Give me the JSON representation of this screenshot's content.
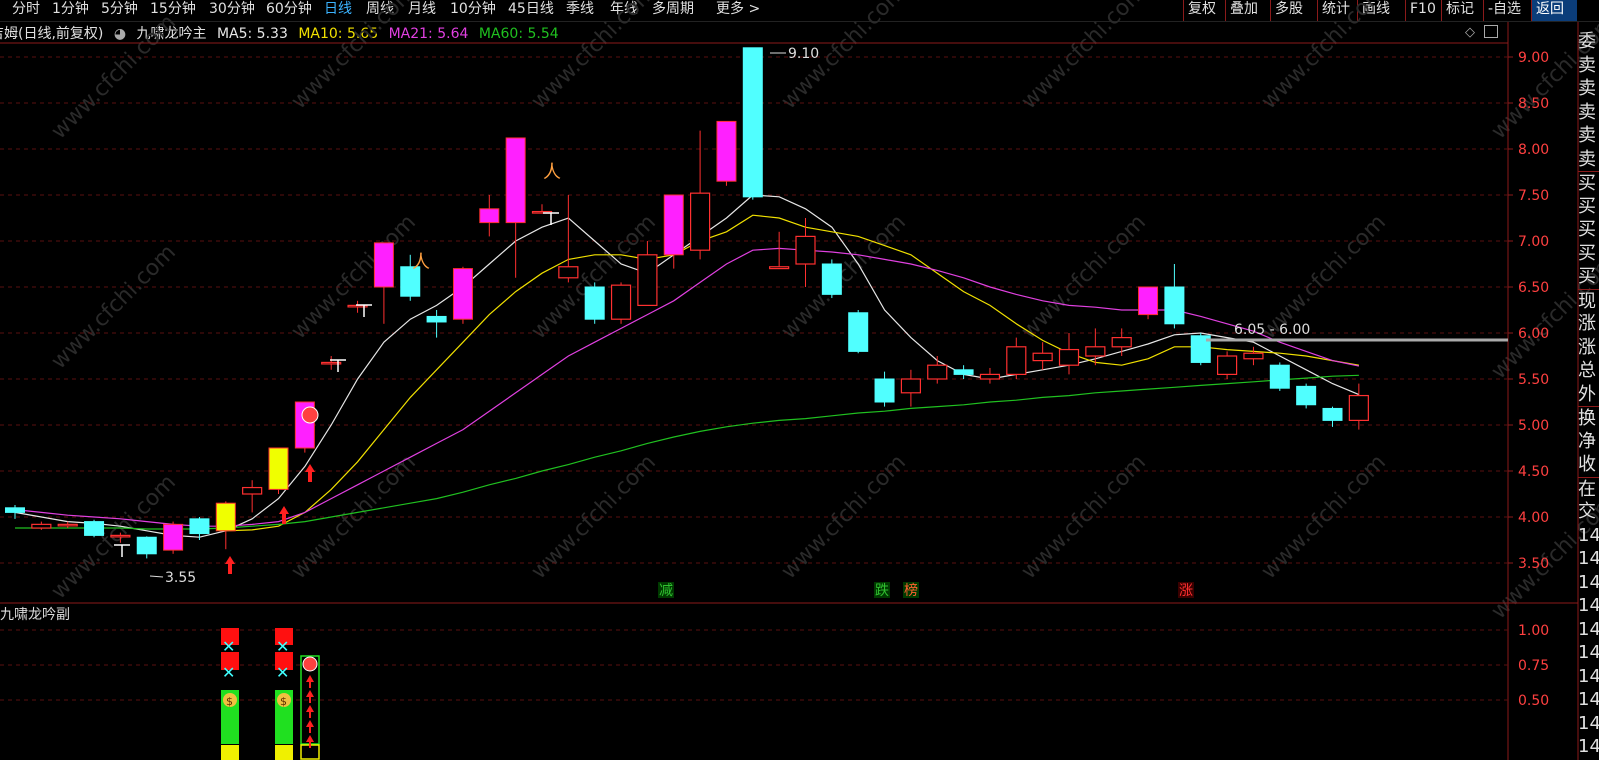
{
  "toolbar": {
    "periods": [
      "分时",
      "1分钟",
      "5分钟",
      "15分钟",
      "30分钟",
      "60分钟",
      "日线",
      "周线",
      "月线",
      "10分钟",
      "45日线",
      "季线",
      "年线",
      "多周期",
      "更多 >"
    ],
    "active_period": "日线",
    "right_buttons": [
      "复权",
      "叠加",
      "多股",
      "统计",
      "画线",
      "F10",
      "标记",
      "-自选",
      "返回"
    ],
    "active_right": "返回"
  },
  "main_legend": {
    "stock": "吉姆(日线,前复权)",
    "indicator": "九啸龙吟主",
    "ma5": "MA5: 5.33",
    "ma10": "MA10: 5.65",
    "ma21": "MA21: 5.64",
    "ma60": "MA60: 5.54"
  },
  "colors": {
    "ma5": "#e6e6e6",
    "ma10": "#f0e000",
    "ma21": "#e040e0",
    "ma60": "#20c020",
    "up": "#ff3030",
    "down": "#50ffff",
    "magenta": "#ff20ff",
    "yellow": "#f0ff00",
    "grid": "#8b1a1a",
    "axis_text": "#ff4040"
  },
  "sub_title": "九啸龙吟副",
  "price_axis": [
    "9.00",
    "8.50",
    "8.00",
    "7.50",
    "7.00",
    "6.50",
    "6.00",
    "5.50",
    "5.00",
    "4.50",
    "4.00",
    "3.50"
  ],
  "sub_axis": [
    "1.00",
    "0.75",
    "0.50"
  ],
  "annotations": {
    "high": "9.10",
    "low": "3.55",
    "range": "6.05 - 6.00",
    "marker_jian": "减",
    "marker_die": "跌",
    "marker_bang": "榜",
    "marker_zhang": "涨"
  },
  "watermark": "www.cfchi.com",
  "right_panel": [
    "委",
    "卖",
    "卖",
    "卖",
    "卖",
    "卖",
    "买",
    "买",
    "买",
    "买",
    "买",
    "现",
    "涨",
    "涨",
    "总",
    "外",
    "换",
    "净",
    "收",
    "在",
    "交",
    "14",
    "14",
    "14",
    "14",
    "14",
    "14",
    "14",
    "14",
    "14",
    "14"
  ],
  "chart_data": {
    "type": "candlestick",
    "ylim": [
      3.3,
      9.2
    ],
    "candles": [
      {
        "o": 4.05,
        "c": 4.1,
        "h": 4.13,
        "l": 3.98,
        "s": "down"
      },
      {
        "o": 3.88,
        "c": 3.92,
        "h": 3.95,
        "l": 3.86,
        "s": "up"
      },
      {
        "o": 3.92,
        "c": 3.92,
        "h": 3.95,
        "l": 3.88,
        "s": "up"
      },
      {
        "o": 3.95,
        "c": 3.8,
        "h": 3.97,
        "l": 3.78,
        "s": "down"
      },
      {
        "o": 3.8,
        "c": 3.8,
        "h": 3.83,
        "l": 3.72,
        "s": "up"
      },
      {
        "o": 3.78,
        "c": 3.6,
        "h": 3.79,
        "l": 3.55,
        "s": "down"
      },
      {
        "o": 3.92,
        "c": 3.64,
        "h": 3.95,
        "l": 3.6,
        "s": "magenta"
      },
      {
        "o": 3.82,
        "c": 3.98,
        "h": 4.0,
        "l": 3.75,
        "s": "down"
      },
      {
        "o": 3.85,
        "c": 4.15,
        "h": 4.17,
        "l": 3.65,
        "s": "yellow"
      },
      {
        "o": 4.25,
        "c": 4.32,
        "h": 4.4,
        "l": 4.05,
        "s": "up"
      },
      {
        "o": 4.3,
        "c": 4.75,
        "h": 4.75,
        "l": 4.25,
        "s": "yellow"
      },
      {
        "o": 4.75,
        "c": 5.25,
        "h": 5.25,
        "l": 4.7,
        "s": "magenta"
      },
      {
        "o": 5.68,
        "c": 5.68,
        "h": 5.75,
        "l": 5.6,
        "s": "up"
      },
      {
        "o": 6.3,
        "c": 6.3,
        "h": 6.35,
        "l": 6.22,
        "s": "up"
      },
      {
        "o": 6.5,
        "c": 6.98,
        "h": 6.98,
        "l": 6.1,
        "s": "magenta"
      },
      {
        "o": 6.72,
        "c": 6.4,
        "h": 6.85,
        "l": 6.35,
        "s": "down"
      },
      {
        "o": 6.12,
        "c": 6.18,
        "h": 6.25,
        "l": 5.95,
        "s": "down"
      },
      {
        "o": 6.15,
        "c": 6.7,
        "h": 6.72,
        "l": 6.1,
        "s": "magenta"
      },
      {
        "o": 7.2,
        "c": 7.35,
        "h": 7.5,
        "l": 7.05,
        "s": "magenta"
      },
      {
        "o": 7.2,
        "c": 8.12,
        "h": 8.12,
        "l": 6.6,
        "s": "magenta"
      },
      {
        "o": 7.32,
        "c": 7.32,
        "h": 7.4,
        "l": 7.3,
        "s": "up"
      },
      {
        "o": 6.6,
        "c": 6.72,
        "h": 7.5,
        "l": 6.55,
        "s": "up"
      },
      {
        "o": 6.5,
        "c": 6.15,
        "h": 6.55,
        "l": 6.1,
        "s": "down"
      },
      {
        "o": 6.15,
        "c": 6.52,
        "h": 6.55,
        "l": 6.1,
        "s": "up"
      },
      {
        "o": 6.3,
        "c": 6.85,
        "h": 7.0,
        "l": 6.3,
        "s": "up"
      },
      {
        "o": 6.85,
        "c": 7.5,
        "h": 7.5,
        "l": 6.7,
        "s": "magenta"
      },
      {
        "o": 6.9,
        "c": 7.52,
        "h": 8.2,
        "l": 6.8,
        "s": "up"
      },
      {
        "o": 7.65,
        "c": 8.3,
        "h": 8.3,
        "l": 7.6,
        "s": "magenta"
      },
      {
        "o": 9.1,
        "c": 7.48,
        "h": 9.1,
        "l": 7.45,
        "s": "down"
      },
      {
        "o": 6.7,
        "c": 6.72,
        "h": 7.1,
        "l": 6.7,
        "s": "up"
      },
      {
        "o": 6.75,
        "c": 7.05,
        "h": 7.25,
        "l": 6.5,
        "s": "up"
      },
      {
        "o": 6.75,
        "c": 6.42,
        "h": 6.8,
        "l": 6.38,
        "s": "down"
      },
      {
        "o": 6.22,
        "c": 5.8,
        "h": 6.25,
        "l": 5.78,
        "s": "down"
      },
      {
        "o": 5.5,
        "c": 5.25,
        "h": 5.58,
        "l": 5.2,
        "s": "down"
      },
      {
        "o": 5.35,
        "c": 5.5,
        "h": 5.6,
        "l": 5.2,
        "s": "up"
      },
      {
        "o": 5.5,
        "c": 5.65,
        "h": 5.75,
        "l": 5.45,
        "s": "up"
      },
      {
        "o": 5.6,
        "c": 5.55,
        "h": 5.65,
        "l": 5.5,
        "s": "down"
      },
      {
        "o": 5.5,
        "c": 5.55,
        "h": 5.62,
        "l": 5.45,
        "s": "up"
      },
      {
        "o": 5.55,
        "c": 5.85,
        "h": 5.95,
        "l": 5.5,
        "s": "up"
      },
      {
        "o": 5.7,
        "c": 5.78,
        "h": 5.9,
        "l": 5.6,
        "s": "up"
      },
      {
        "o": 5.65,
        "c": 5.82,
        "h": 6.0,
        "l": 5.55,
        "s": "up"
      },
      {
        "o": 5.75,
        "c": 5.85,
        "h": 6.05,
        "l": 5.65,
        "s": "up"
      },
      {
        "o": 5.85,
        "c": 5.95,
        "h": 6.05,
        "l": 5.75,
        "s": "up"
      },
      {
        "o": 6.2,
        "c": 6.5,
        "h": 6.5,
        "l": 6.15,
        "s": "magenta"
      },
      {
        "o": 6.5,
        "c": 6.1,
        "h": 6.75,
        "l": 6.05,
        "s": "down"
      },
      {
        "o": 5.97,
        "c": 5.68,
        "h": 6.0,
        "l": 5.65,
        "s": "down"
      },
      {
        "o": 5.55,
        "c": 5.75,
        "h": 5.8,
        "l": 5.5,
        "s": "up"
      },
      {
        "o": 5.72,
        "c": 5.78,
        "h": 5.85,
        "l": 5.65,
        "s": "up"
      },
      {
        "o": 5.65,
        "c": 5.4,
        "h": 5.68,
        "l": 5.37,
        "s": "down"
      },
      {
        "o": 5.42,
        "c": 5.22,
        "h": 5.45,
        "l": 5.18,
        "s": "down"
      },
      {
        "o": 5.18,
        "c": 5.05,
        "h": 5.2,
        "l": 4.98,
        "s": "down"
      },
      {
        "o": 5.05,
        "c": 5.32,
        "h": 5.45,
        "l": 4.95,
        "s": "up"
      }
    ],
    "series": [
      {
        "name": "MA5",
        "values": [
          4.05,
          4.0,
          3.95,
          3.93,
          3.9,
          3.85,
          3.8,
          3.78,
          3.85,
          3.98,
          4.2,
          4.55,
          5.0,
          5.5,
          5.9,
          6.15,
          6.3,
          6.5,
          6.75,
          7.0,
          7.15,
          7.25,
          7.0,
          6.75,
          6.65,
          6.85,
          7.05,
          7.25,
          7.5,
          7.48,
          7.35,
          7.15,
          6.75,
          6.25,
          5.95,
          5.7,
          5.55,
          5.5,
          5.55,
          5.6,
          5.65,
          5.72,
          5.8,
          5.88,
          5.98,
          6.0,
          5.95,
          5.9,
          5.75,
          5.6,
          5.45,
          5.33
        ]
      },
      {
        "name": "MA10",
        "values": [
          null,
          null,
          null,
          null,
          null,
          null,
          null,
          null,
          3.85,
          3.86,
          3.9,
          4.05,
          4.3,
          4.6,
          4.95,
          5.3,
          5.6,
          5.9,
          6.2,
          6.45,
          6.65,
          6.8,
          6.85,
          6.85,
          6.8,
          6.85,
          7.0,
          7.1,
          7.28,
          7.25,
          7.15,
          7.1,
          7.05,
          6.95,
          6.85,
          6.65,
          6.45,
          6.3,
          6.1,
          5.92,
          5.78,
          5.68,
          5.65,
          5.72,
          5.85,
          5.85,
          5.82,
          5.8,
          5.78,
          5.75,
          5.7,
          5.65
        ]
      },
      {
        "name": "MA21",
        "values": [
          4.08,
          4.05,
          4.02,
          4.0,
          3.98,
          3.95,
          3.92,
          3.9,
          3.9,
          3.92,
          3.95,
          4.05,
          4.2,
          4.35,
          4.5,
          4.65,
          4.8,
          4.95,
          5.15,
          5.35,
          5.55,
          5.75,
          5.9,
          6.05,
          6.2,
          6.35,
          6.55,
          6.75,
          6.9,
          6.92,
          6.9,
          6.88,
          6.85,
          6.8,
          6.75,
          6.68,
          6.6,
          6.5,
          6.42,
          6.35,
          6.3,
          6.28,
          6.25,
          6.25,
          6.25,
          6.18,
          6.1,
          6.02,
          5.9,
          5.8,
          5.7,
          5.64
        ]
      },
      {
        "name": "MA60",
        "values": [
          3.88,
          3.88,
          3.88,
          3.88,
          3.88,
          3.87,
          3.87,
          3.87,
          3.88,
          3.9,
          3.92,
          3.95,
          4.0,
          4.05,
          4.1,
          4.15,
          4.2,
          4.27,
          4.35,
          4.42,
          4.5,
          4.57,
          4.65,
          4.72,
          4.8,
          4.87,
          4.93,
          4.98,
          5.02,
          5.05,
          5.07,
          5.1,
          5.13,
          5.15,
          5.18,
          5.2,
          5.22,
          5.25,
          5.27,
          5.3,
          5.32,
          5.35,
          5.37,
          5.39,
          5.41,
          5.43,
          5.45,
          5.47,
          5.49,
          5.51,
          5.53,
          5.54
        ]
      }
    ]
  }
}
